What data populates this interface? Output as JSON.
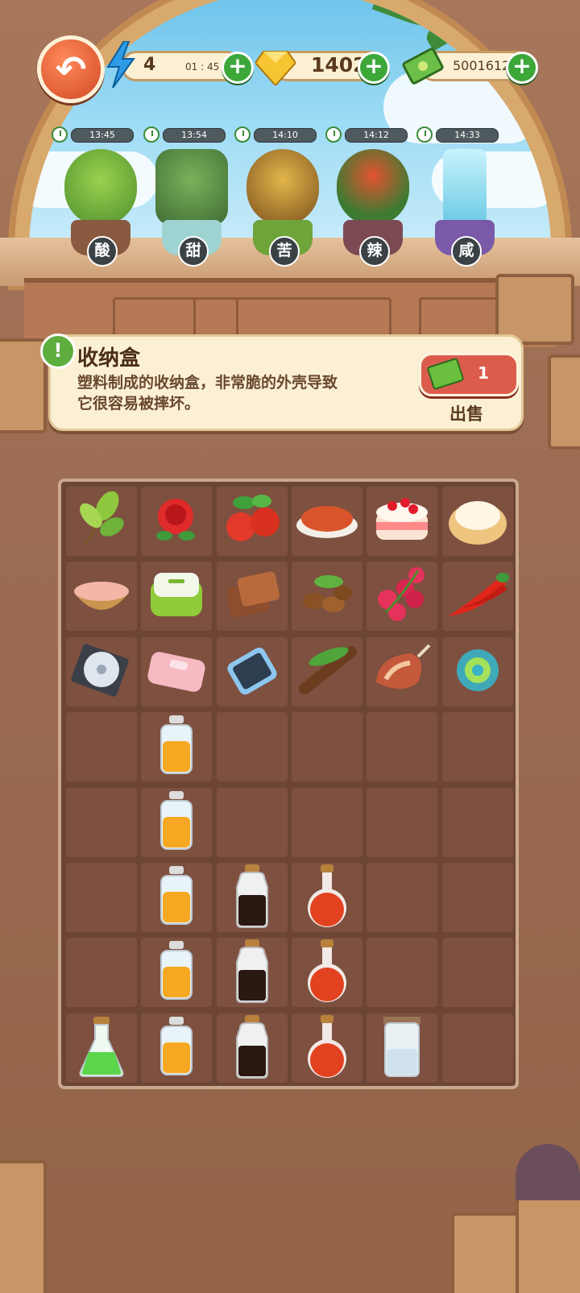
{
  "header": {
    "energy": {
      "icon": "lightning-icon",
      "value": "4",
      "timer": "01 : 45"
    },
    "gems": {
      "icon": "gem-icon",
      "value": "1402"
    },
    "cash": {
      "icon": "cash-icon",
      "value": "5001612"
    }
  },
  "plants": [
    {
      "label": "酸",
      "timer": "13:45",
      "color": "#8cc63f"
    },
    {
      "label": "甜",
      "timer": "13:54",
      "color": "#6d9f4f"
    },
    {
      "label": "苦",
      "timer": "14:10",
      "color": "#c59a34"
    },
    {
      "label": "辣",
      "timer": "14:12",
      "color": "#d84a2b"
    },
    {
      "label": "咸",
      "timer": "14:33",
      "color": "#9fe0f2"
    }
  ],
  "info": {
    "title": "收纳盒",
    "description_line1": "塑料制成的收纳盒，非常脆的外壳导致",
    "description_line2": "它很容易被摔坏。",
    "price": "1",
    "sell_label": "出售"
  },
  "inventory": [
    [
      "tea-leaves",
      "rose",
      "hawthorn-berries",
      "chili-powder",
      "strawberry-cake",
      "cream-puff"
    ],
    [
      "sea-salt-bowl",
      "lunch-box",
      "brown-sugar",
      "coffee-beans",
      "raspberries",
      "red-chili"
    ],
    [
      "cd-disc",
      "pink-wallet",
      "smartphone",
      "tamarind",
      "ham",
      "swirl-orb"
    ],
    [
      "",
      "yellow-jar",
      "",
      "",
      "",
      ""
    ],
    [
      "",
      "yellow-jar",
      "",
      "",
      "",
      ""
    ],
    [
      "",
      "yellow-jar",
      "soy-bottle",
      "red-flask",
      "",
      ""
    ],
    [
      "",
      "yellow-jar",
      "soy-bottle",
      "red-flask",
      "",
      ""
    ],
    [
      "green-flask",
      "yellow-jar",
      "soy-bottle",
      "red-flask",
      "salt-jar",
      ""
    ]
  ]
}
